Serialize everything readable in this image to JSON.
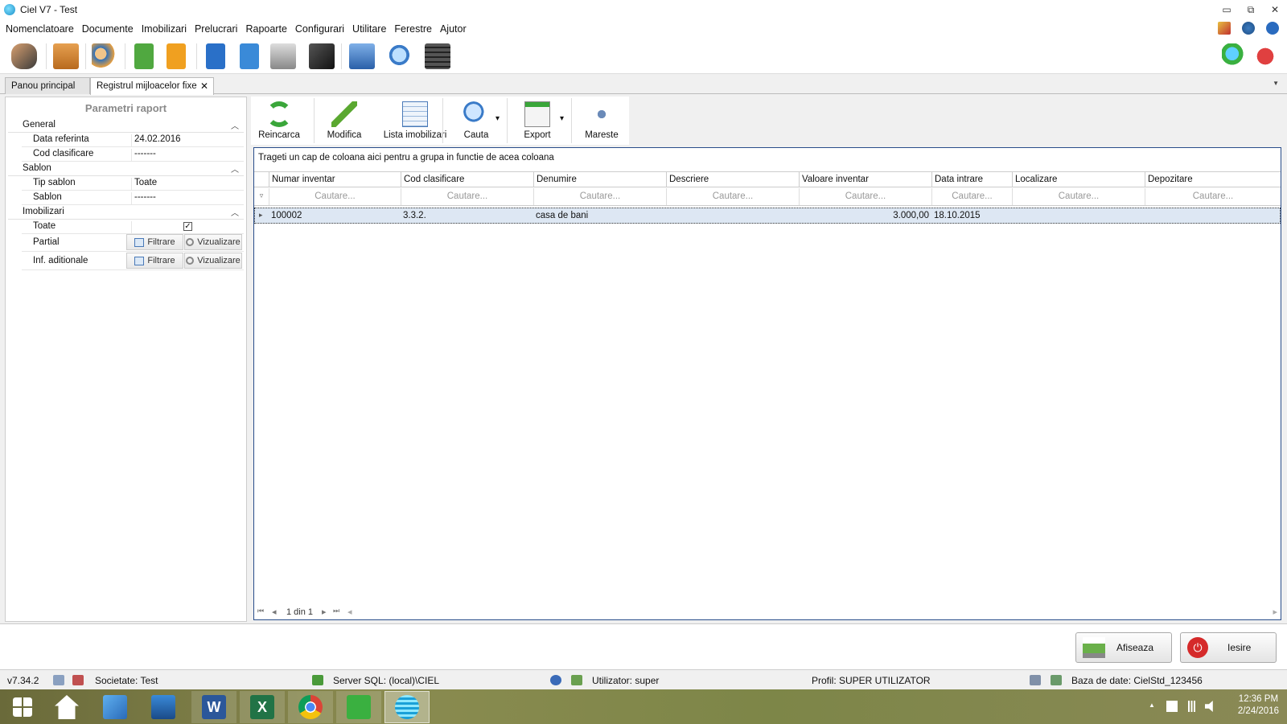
{
  "window": {
    "title": "Ciel V7 - Test",
    "minimize_glyph": "▭",
    "restore_glyph": "⧉",
    "close_glyph": "✕"
  },
  "menu": {
    "items": [
      "Nomenclatoare",
      "Documente",
      "Imobilizari",
      "Prelucrari",
      "Rapoarte",
      "Configurari",
      "Utilitare",
      "Ferestre",
      "Ajutor"
    ]
  },
  "tabs": {
    "items": [
      "Panou principal",
      "Registrul mijloacelor fixe"
    ],
    "close_glyph": "✕",
    "overflow_glyph": "▼"
  },
  "params": {
    "title": "Parametri raport",
    "groups": {
      "general": {
        "label": "General",
        "chevron": "︿"
      },
      "sablon": {
        "label": "Sablon",
        "chevron": "︿"
      },
      "imobilizari": {
        "label": "Imobilizari",
        "chevron": "︿"
      }
    },
    "rows": {
      "data_referinta": {
        "label": "Data referinta",
        "value": "24.02.2016"
      },
      "cod_clasificare": {
        "label": "Cod clasificare",
        "value": "-------"
      },
      "tip_sablon": {
        "label": "Tip sablon",
        "value": "Toate"
      },
      "sablon": {
        "label": "Sablon",
        "value": "-------"
      },
      "toate": {
        "label": "Toate",
        "checked": true,
        "check_glyph": "✓"
      },
      "partial": {
        "label": "Partial"
      },
      "inf_aditionale": {
        "label": "Inf. aditionale"
      }
    },
    "filter_label": "Filtrare",
    "view_label": "Vizualizare"
  },
  "report_toolbar": {
    "reincarca": "Reincarca",
    "modifica": "Modifica",
    "lista": "Lista imobilizari",
    "cauta": "Cauta",
    "export": "Export",
    "mareste": "Mareste",
    "dropdown_glyph": "▾"
  },
  "grid": {
    "group_hint": "Trageti un cap de coloana aici pentru a grupa in functie de acea coloana",
    "columns": [
      "Numar inventar",
      "Cod clasificare",
      "Denumire",
      "Descriere",
      "Valoare inventar",
      "Data intrare",
      "Localizare",
      "Depozitare"
    ],
    "filter_placeholder": "Cautare...",
    "filter_glyph": "▿",
    "row_indicator": "▸",
    "rows": [
      {
        "numar": "100002",
        "cod": "3.3.2.",
        "denumire": "casa de bani",
        "descriere": "",
        "valoare": "3.000,00",
        "data": "18.10.2015",
        "localizare": "",
        "depozitare": ""
      }
    ],
    "pager": {
      "text": "1 din 1",
      "first": "⏮",
      "prev": "◂",
      "next": "▸",
      "last": "⏭",
      "scroll_left": "◂",
      "scroll_right": "▸"
    }
  },
  "actions": {
    "afiseaza": "Afiseaza",
    "iesire": "Iesire",
    "power_glyph": "⏻"
  },
  "status": {
    "version": "v7.34.2",
    "societate": "Societate: Test",
    "server": "Server SQL: (local)\\CIEL",
    "utilizator": "Utilizator: super",
    "profil": "Profil: SUPER UTILIZATOR",
    "baza": "Baza de date: CielStd_123456"
  },
  "taskbar": {
    "time": "12:36 PM",
    "date": "2/24/2016",
    "word_letter": "W",
    "excel_letter": "X",
    "tray_up_glyph": "▲"
  }
}
